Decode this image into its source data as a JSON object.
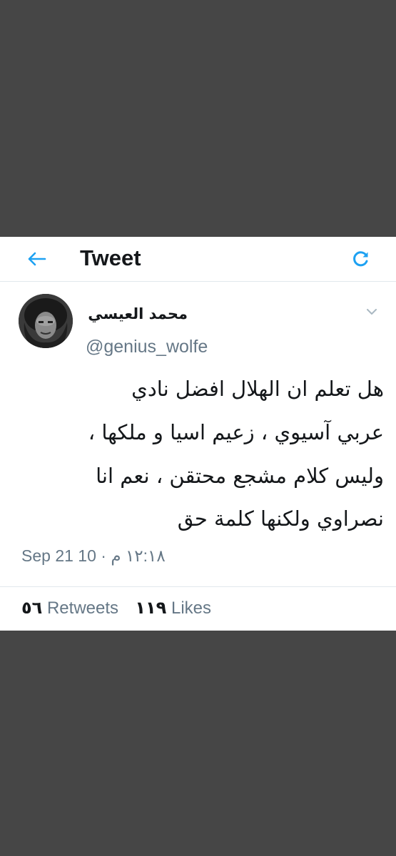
{
  "header": {
    "title": "Tweet",
    "back_icon": "arrow-left-icon",
    "refresh_icon": "refresh-icon",
    "accent_color": "#1da1f2"
  },
  "tweet": {
    "display_name": "محمد العيسي",
    "handle": "@genius_wolfe",
    "text_lines": [
      "هل تعلم ان الهلال افضل نادي",
      "عربي آسيوي ، زعيم اسيا و ملكها ،",
      " وليس كلام مشجع محتقن ،  نعم انا",
      "نصراوي ولكنها كلمة حق"
    ],
    "timestamp": "Sep 21 10 · ١٢:١٨ م"
  },
  "stats": {
    "retweets_count": "٥٦",
    "retweets_label": "Retweets",
    "likes_count": "١١٩",
    "likes_label": "Likes"
  }
}
